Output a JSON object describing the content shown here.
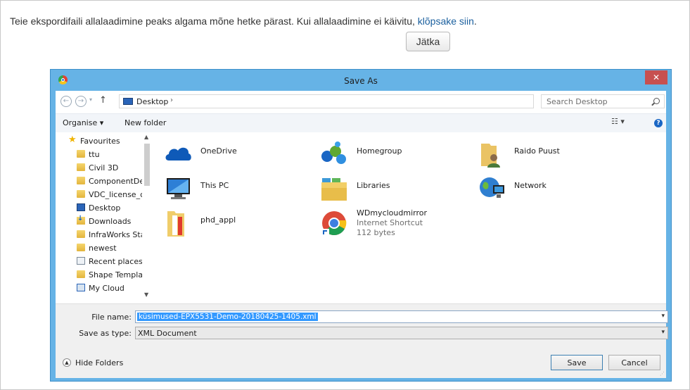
{
  "page": {
    "message": "Teie ekspordifaili allalaadimine peaks algama mõne hetke pärast. Kui allalaadimine ei käivitu,",
    "link": "klõpsake siin",
    "link_suffix": ".",
    "continue_button": "Jätka"
  },
  "dialog": {
    "title": "Save As",
    "close_glyph": "✕",
    "address": {
      "path": "Desktop",
      "path_chevron": "›",
      "search_placeholder": "Search Desktop"
    },
    "toolbar": {
      "organise": "Organise ▾",
      "new_folder": "New folder",
      "help": "?"
    },
    "nav_items": [
      {
        "label": "Favourites",
        "icon": "star-icon"
      },
      {
        "label": "ttu",
        "icon": "folder-icon"
      },
      {
        "label": "Civil 3D",
        "icon": "folder-icon"
      },
      {
        "label": "ComponentDefi",
        "icon": "folder-icon"
      },
      {
        "label": "VDC_license_cre",
        "icon": "folder-icon"
      },
      {
        "label": "Desktop",
        "icon": "desktop-icon"
      },
      {
        "label": "Downloads",
        "icon": "downloads-icon"
      },
      {
        "label": "InfraWorks Stan",
        "icon": "folder-icon"
      },
      {
        "label": "newest",
        "icon": "folder-icon"
      },
      {
        "label": "Recent places",
        "icon": "recent-places-icon"
      },
      {
        "label": "Shape Template",
        "icon": "folder-icon"
      },
      {
        "label": "My Cloud",
        "icon": "cloud-drive-icon"
      }
    ],
    "items": [
      {
        "name": "OneDrive",
        "icon": "onedrive-icon"
      },
      {
        "name": "Homegroup",
        "icon": "homegroup-icon"
      },
      {
        "name": "Raido Puust",
        "icon": "user-folder-icon"
      },
      {
        "name": "This PC",
        "icon": "this-pc-icon"
      },
      {
        "name": "Libraries",
        "icon": "libraries-icon"
      },
      {
        "name": "Network",
        "icon": "network-icon"
      },
      {
        "name": "phd_appl",
        "icon": "folder-icon"
      },
      {
        "name": "WDmycloudmirror",
        "icon": "chrome-shortcut-icon",
        "type": "Internet Shortcut",
        "size": "112 bytes"
      }
    ],
    "file_name_label": "File name:",
    "file_name_value": "küsimused-EPX5531-Demo-20180425-1405.xml",
    "save_type_label": "Save as type:",
    "save_type_value": "XML Document",
    "hide_folders": "Hide Folders",
    "save_button": "Save",
    "cancel_button": "Cancel"
  },
  "colors": {
    "titlebar": "#66b3e6",
    "close_button": "#c75050",
    "link": "#1a5f9e",
    "selection": "#3399ff"
  }
}
